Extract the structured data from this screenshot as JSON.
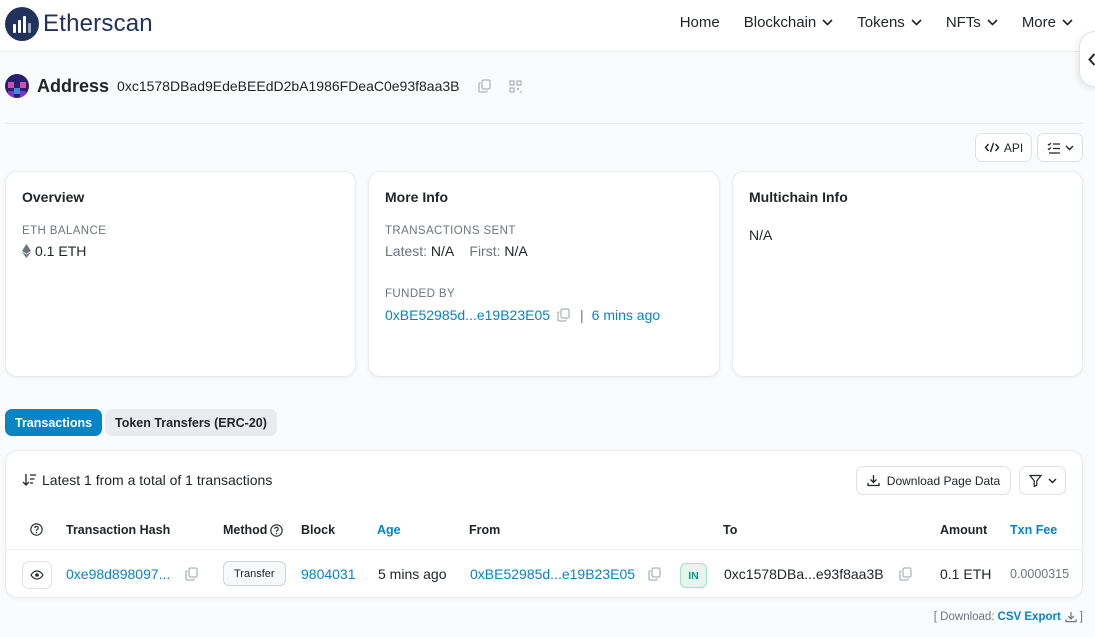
{
  "header": {
    "brand": "Etherscan",
    "nav": [
      "Home",
      "Blockchain",
      "Tokens",
      "NFTs",
      "More"
    ]
  },
  "address": {
    "title": "Address",
    "value": "0xc1578DBad9EdeBEEdD2bA1986FDeaC0e93f8aa3B"
  },
  "toolbar": {
    "api_label": "API"
  },
  "overview": {
    "title": "Overview",
    "balance_label": "ETH BALANCE",
    "balance_value": "0.1 ETH"
  },
  "more_info": {
    "title": "More Info",
    "tx_sent_label": "TRANSACTIONS SENT",
    "latest_label": "Latest:",
    "latest_value": "N/A",
    "first_label": "First:",
    "first_value": "N/A",
    "funded_label": "FUNDED BY",
    "funded_address": "0xBE52985d...e19B23E05",
    "funded_separator": "|",
    "funded_age": "6 mins ago"
  },
  "multichain": {
    "title": "Multichain Info",
    "value": "N/A"
  },
  "tabs": [
    "Transactions",
    "Token Transfers (ERC-20)"
  ],
  "table": {
    "summary": "Latest 1 from a total of 1 transactions",
    "download_label": "Download Page Data",
    "columns": [
      "Transaction Hash",
      "Method",
      "Block",
      "Age",
      "From",
      "To",
      "Amount",
      "Txn Fee"
    ],
    "rows": [
      {
        "hash": "0xe98d898097...",
        "method": "Transfer",
        "block": "9804031",
        "age": "5 mins ago",
        "from": "0xBE52985d...e19B23E05",
        "direction": "IN",
        "to": "0xc1578DBa...e93f8aa3B",
        "amount": "0.1 ETH",
        "fee": "0.0000315"
      }
    ]
  },
  "footer": {
    "download_prefix": "[ Download:",
    "csv_label": "CSV Export",
    "suffix": "]"
  },
  "colors": {
    "brand_navy": "#21325b",
    "link_blue": "#0784c3",
    "in_badge_green": "#00a186"
  }
}
